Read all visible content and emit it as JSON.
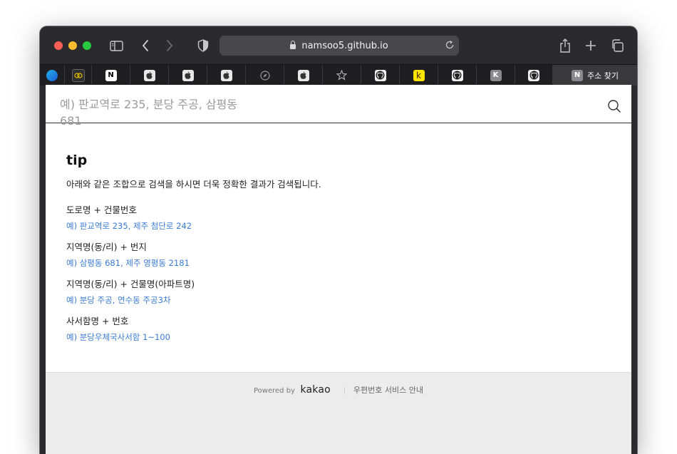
{
  "browser": {
    "url": "namsoo5.github.io",
    "tabs": [
      {
        "icon": "edge-icon"
      },
      {
        "icon": "link-icon"
      },
      {
        "icon": "notion-icon",
        "glyph": "N"
      },
      {
        "icon": "apple-icon"
      },
      {
        "icon": "apple-icon"
      },
      {
        "icon": "apple-icon"
      },
      {
        "icon": "compass-icon"
      },
      {
        "icon": "apple-icon"
      },
      {
        "icon": "star-icon"
      },
      {
        "icon": "github-icon"
      },
      {
        "icon": "kakao-k-icon",
        "glyph": "k",
        "color": "#fee500"
      },
      {
        "icon": "github-icon"
      },
      {
        "icon": "k-icon",
        "glyph": "K"
      },
      {
        "icon": "github-icon"
      }
    ],
    "active_tab": {
      "glyph": "N",
      "label": "주소 찾기"
    }
  },
  "search": {
    "placeholder": "예) 판교역로 235, 분당 주공, 삼평동 681"
  },
  "tip": {
    "title": "tip",
    "description": "아래와 같은 조합으로 검색을 하시면 더욱 정확한 결과가 검색됩니다.",
    "items": [
      {
        "head": "도로명 + 건물번호",
        "example": "예) 판교역로 235,  제주 첨단로 242"
      },
      {
        "head": "지역명(동/리) + 번지",
        "example": "예) 삼평동 681,  제주 영평동 2181"
      },
      {
        "head": "지역명(동/리) + 건물명(아파트명)",
        "example": "예) 분당 주공,  연수동 주공3차"
      },
      {
        "head": "사서함명 + 번호",
        "example": "예) 분당우체국사서함 1~100"
      }
    ]
  },
  "footer": {
    "powered_by": "Powered by",
    "brand": "kakao",
    "link": "우편번호 서비스 안내"
  }
}
